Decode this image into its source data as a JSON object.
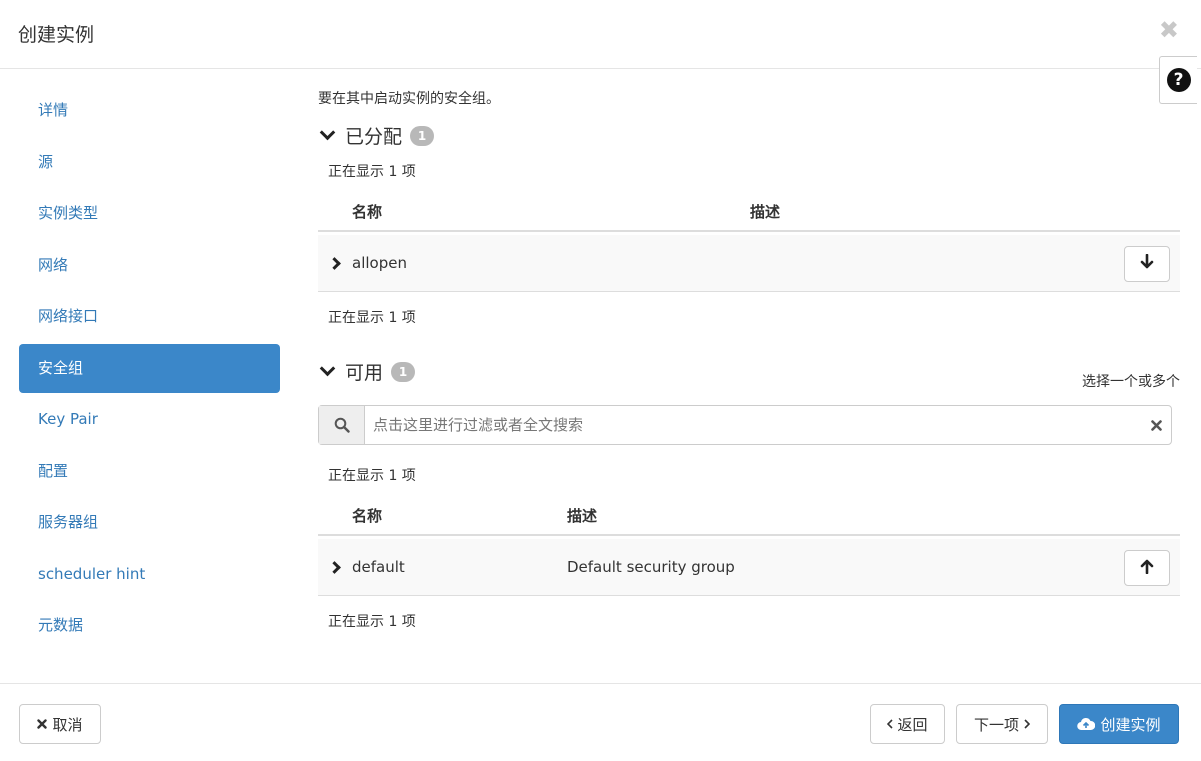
{
  "header": {
    "title": "创建实例",
    "close_glyph": "✖",
    "help_glyph": "?"
  },
  "sidebar": {
    "items": [
      {
        "label": "详情"
      },
      {
        "label": "源"
      },
      {
        "label": "实例类型"
      },
      {
        "label": "网络"
      },
      {
        "label": "网络接口"
      },
      {
        "label": "安全组",
        "active": true
      },
      {
        "label": "Key Pair"
      },
      {
        "label": "配置"
      },
      {
        "label": "服务器组"
      },
      {
        "label": "scheduler hint"
      },
      {
        "label": "元数据"
      }
    ]
  },
  "main": {
    "intro": "要在其中启动实例的安全组。",
    "allocated": {
      "title": "已分配",
      "badge": "1",
      "count_top": "正在显示 1 项",
      "columns": [
        "名称",
        "描述"
      ],
      "rows": [
        {
          "name": "allopen",
          "description": ""
        }
      ],
      "count_bottom": "正在显示 1 项"
    },
    "available": {
      "title": "可用",
      "badge": "1",
      "select_hint": "选择一个或多个",
      "search_placeholder": "点击这里进行过滤或者全文搜索",
      "search_value": "",
      "count_top": "正在显示 1 项",
      "columns": [
        "名称",
        "描述"
      ],
      "rows": [
        {
          "name": "default",
          "description": "Default security group"
        }
      ],
      "count_bottom": "正在显示 1 项"
    }
  },
  "footer": {
    "cancel_label": "取消",
    "back_label": "返回",
    "next_label": "下一项",
    "create_label": "创建实例"
  },
  "icons": {
    "close": "close-icon",
    "help": "question-circle-icon",
    "search": "search-icon",
    "clear": "clear-icon",
    "arrow_down": "arrow-down-icon",
    "arrow_up": "arrow-up-icon",
    "cloud_upload": "cloud-upload-icon"
  },
  "colors": {
    "primary": "#3b87c9",
    "link": "#337ab7",
    "badge": "#b8b8b8"
  }
}
